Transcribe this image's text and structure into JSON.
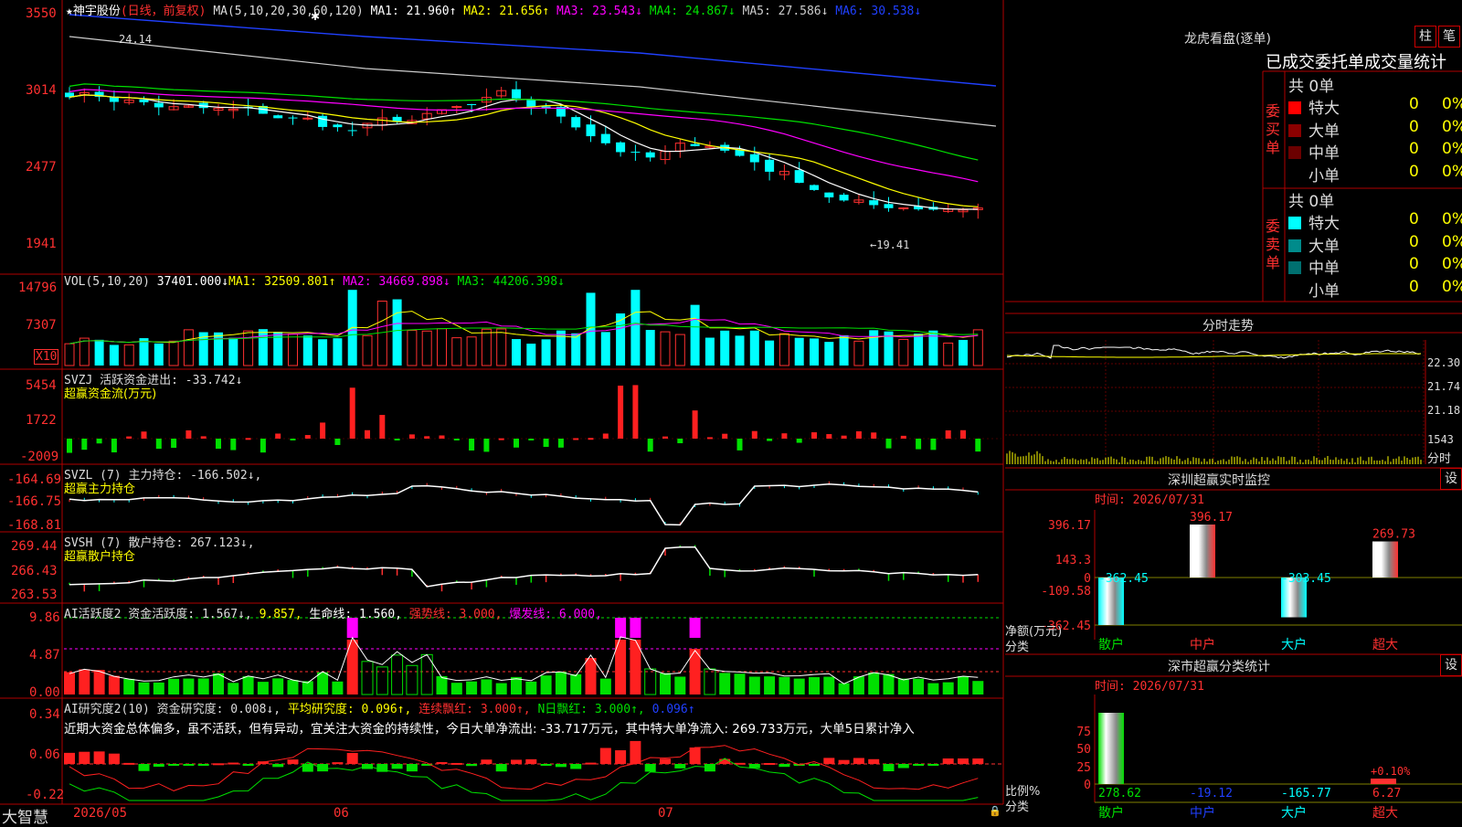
{
  "stock": {
    "name": "神宇股份",
    "mode": "(日线，前复权)",
    "star": "★"
  },
  "price_panel": {
    "ma_title": "MA(5,10,20,30,60,120)",
    "ma1": "MA1: 21.960↑",
    "ma2": "MA2: 21.656↑",
    "ma3": "MA3: 23.543↓",
    "ma4": "MA4: 24.867↓",
    "ma5": "MA5: 27.586↓",
    "ma6": "MA6: 30.538↓",
    "ticks": [
      "3550",
      "3014",
      "2477",
      "1941"
    ],
    "high_label": "24.14",
    "low_label": "←19.41"
  },
  "vol_panel": {
    "title": "VOL(5,10,20)",
    "value": "37401.000↓",
    "ma1": "MA1: 32509.801↑",
    "ma2": "MA2: 34669.898↓",
    "ma3": "MA3: 44206.398↓",
    "ticks": [
      "14796",
      "7307"
    ],
    "unit": "X10"
  },
  "svzj_panel": {
    "title": "SVZJ  活跃资金进出: -33.742↓",
    "sub": "超赢资金流(万元)",
    "ticks": [
      "5454",
      "1722",
      "-2009"
    ]
  },
  "svzl_panel": {
    "title": "SVZL (7) 主力持仓: -166.502↓,",
    "sub": "超赢主力持仓",
    "ticks": [
      "-164.69",
      "-166.75",
      "-168.81"
    ]
  },
  "svsh_panel": {
    "title": "SVSH (7) 散户持仓: 267.123↓,",
    "sub": "超赢散户持仓",
    "ticks": [
      "269.44",
      "266.43",
      "263.53"
    ]
  },
  "ai1_panel": {
    "title": "AI活跃度2 资金活跃度: 1.567↓,",
    "v2": "9.857,",
    "v3": "生命线: 1.560,",
    "v4": "强势线: 3.000,",
    "v5": "爆发线: 6.000,",
    "ticks": [
      "9.86",
      "4.87",
      "0.00"
    ]
  },
  "ai2_panel": {
    "title": "AI研究度2(10) 资金研究度: 0.008↓,",
    "v2": "平均研究度: 0.096↑,",
    "v3": "连续飘红: 3.000↑,",
    "v4": "N日飘红: 3.000↑,",
    "v5": "0.096↑",
    "comment": "近期大资金总体偏多，虽不活跃，但有异动，宜关注大资金的持续性，今日大单净流出: -33.717万元，其中特大单净流入: 269.733万元，大单5日累计净入",
    "ticks": [
      "0.34",
      "0.06",
      "-0.22"
    ]
  },
  "bottom": {
    "logo": "大智慧",
    "dates": [
      "2026/05",
      "06",
      "07"
    ]
  },
  "dragon_tiger": {
    "title": "龙虎看盘(逐单)",
    "btn1": "柱",
    "btn2": "笔",
    "header": "已成交委托单成交量统计",
    "buy_label": "委买单",
    "sell_label": "委卖单",
    "buy_total": "共 0单",
    "sell_total": "共 0单",
    "rows": [
      {
        "label": "特大",
        "count": "0",
        "pct": "0%"
      },
      {
        "label": "大单",
        "count": "0",
        "pct": "0%"
      },
      {
        "label": "中单",
        "count": "0",
        "pct": "0%"
      },
      {
        "label": "小单",
        "count": "0",
        "pct": "0%"
      }
    ],
    "buy_colors": [
      "#ff0000",
      "#8b0000",
      "#6b0000",
      ""
    ],
    "sell_colors": [
      "#00ffff",
      "#008b8b",
      "#007070",
      ""
    ]
  },
  "intraday": {
    "title": "分时走势",
    "ticks": [
      "22.30",
      "21.74",
      "21.18"
    ],
    "vol_tick": "1543",
    "label": "分时"
  },
  "sz_monitor": {
    "title": "深圳超赢实时监控",
    "btn": "设",
    "time": "时间: 2026/07/31",
    "unit": "净额(万元)",
    "cat": "分类",
    "ticks": [
      "396.17",
      "143.3",
      "0",
      "-109.58",
      "-362.45"
    ],
    "categories": [
      "散户",
      "中户",
      "大户",
      "超大"
    ],
    "values": [
      -362.45,
      396.17,
      -303.45,
      269.73
    ],
    "labels": [
      "-362.45",
      "396.17",
      "-303.45",
      "269.73"
    ]
  },
  "sz_stats": {
    "title": "深市超赢分类统计",
    "btn": "设",
    "time": "时间: 2026/07/31",
    "unit": "比例%",
    "cat": "分类",
    "ticks": [
      "75",
      "50",
      "25",
      "0"
    ],
    "categories": [
      "散户",
      "中户",
      "大户",
      "超大"
    ],
    "values": [
      "278.62",
      "-19.12",
      "-165.77",
      "6.27"
    ],
    "extra": "+0.10%"
  }
}
